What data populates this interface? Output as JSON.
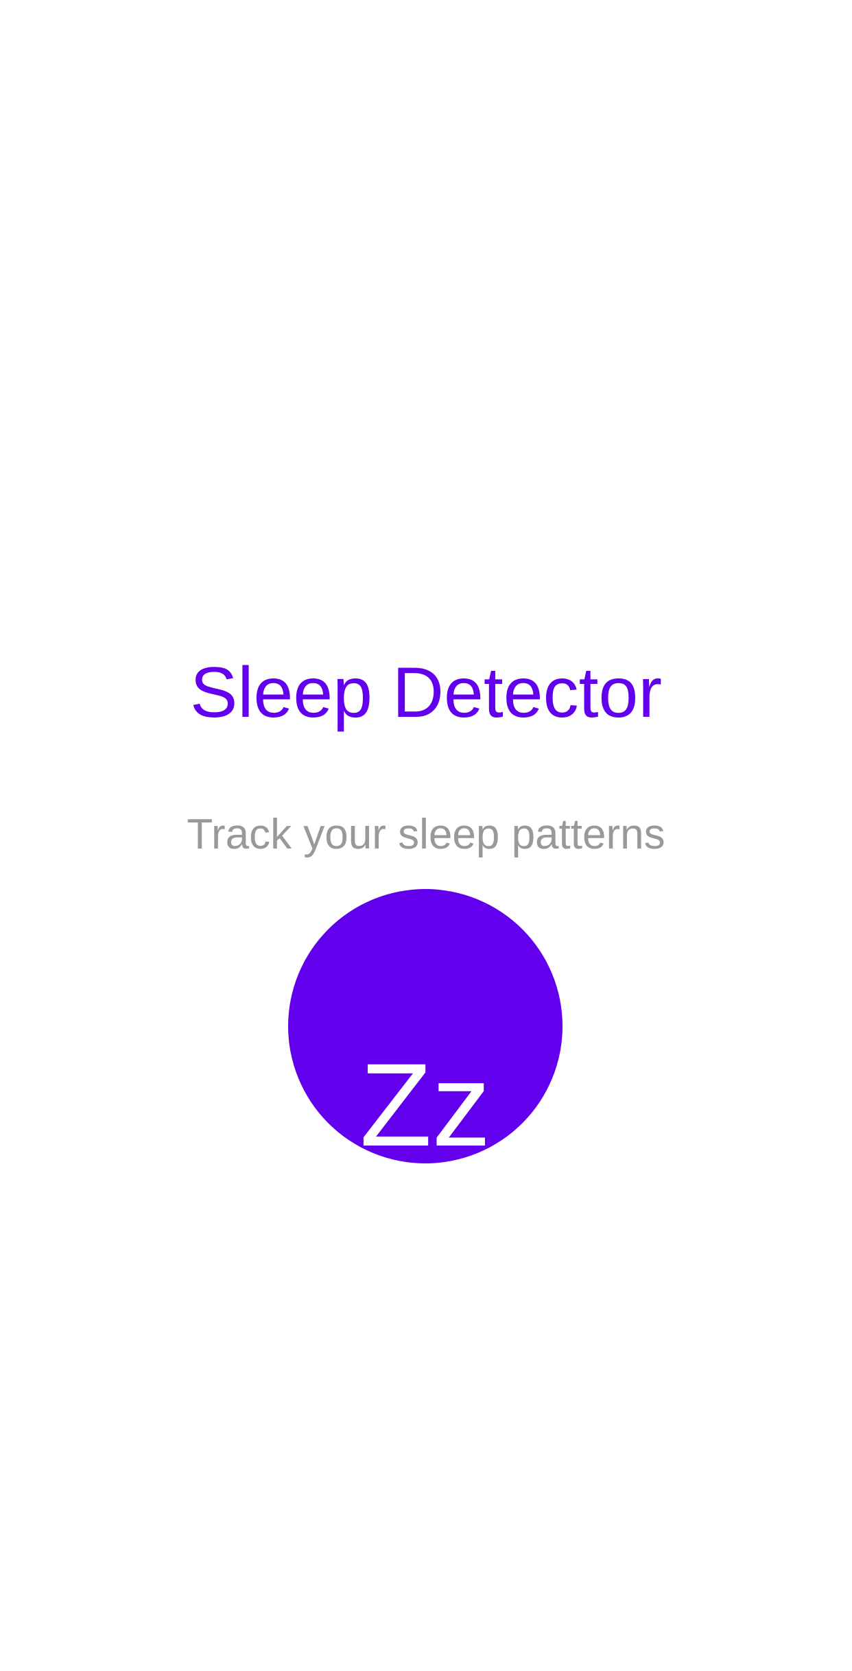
{
  "app": {
    "title": "Sleep Detector",
    "subtitle": "Track your sleep patterns"
  },
  "sleep_button": {
    "label": "Zz"
  },
  "colors": {
    "accent": "#6200ee",
    "subtitle": "#999999",
    "background": "#ffffff",
    "button_text": "#ffffff"
  }
}
